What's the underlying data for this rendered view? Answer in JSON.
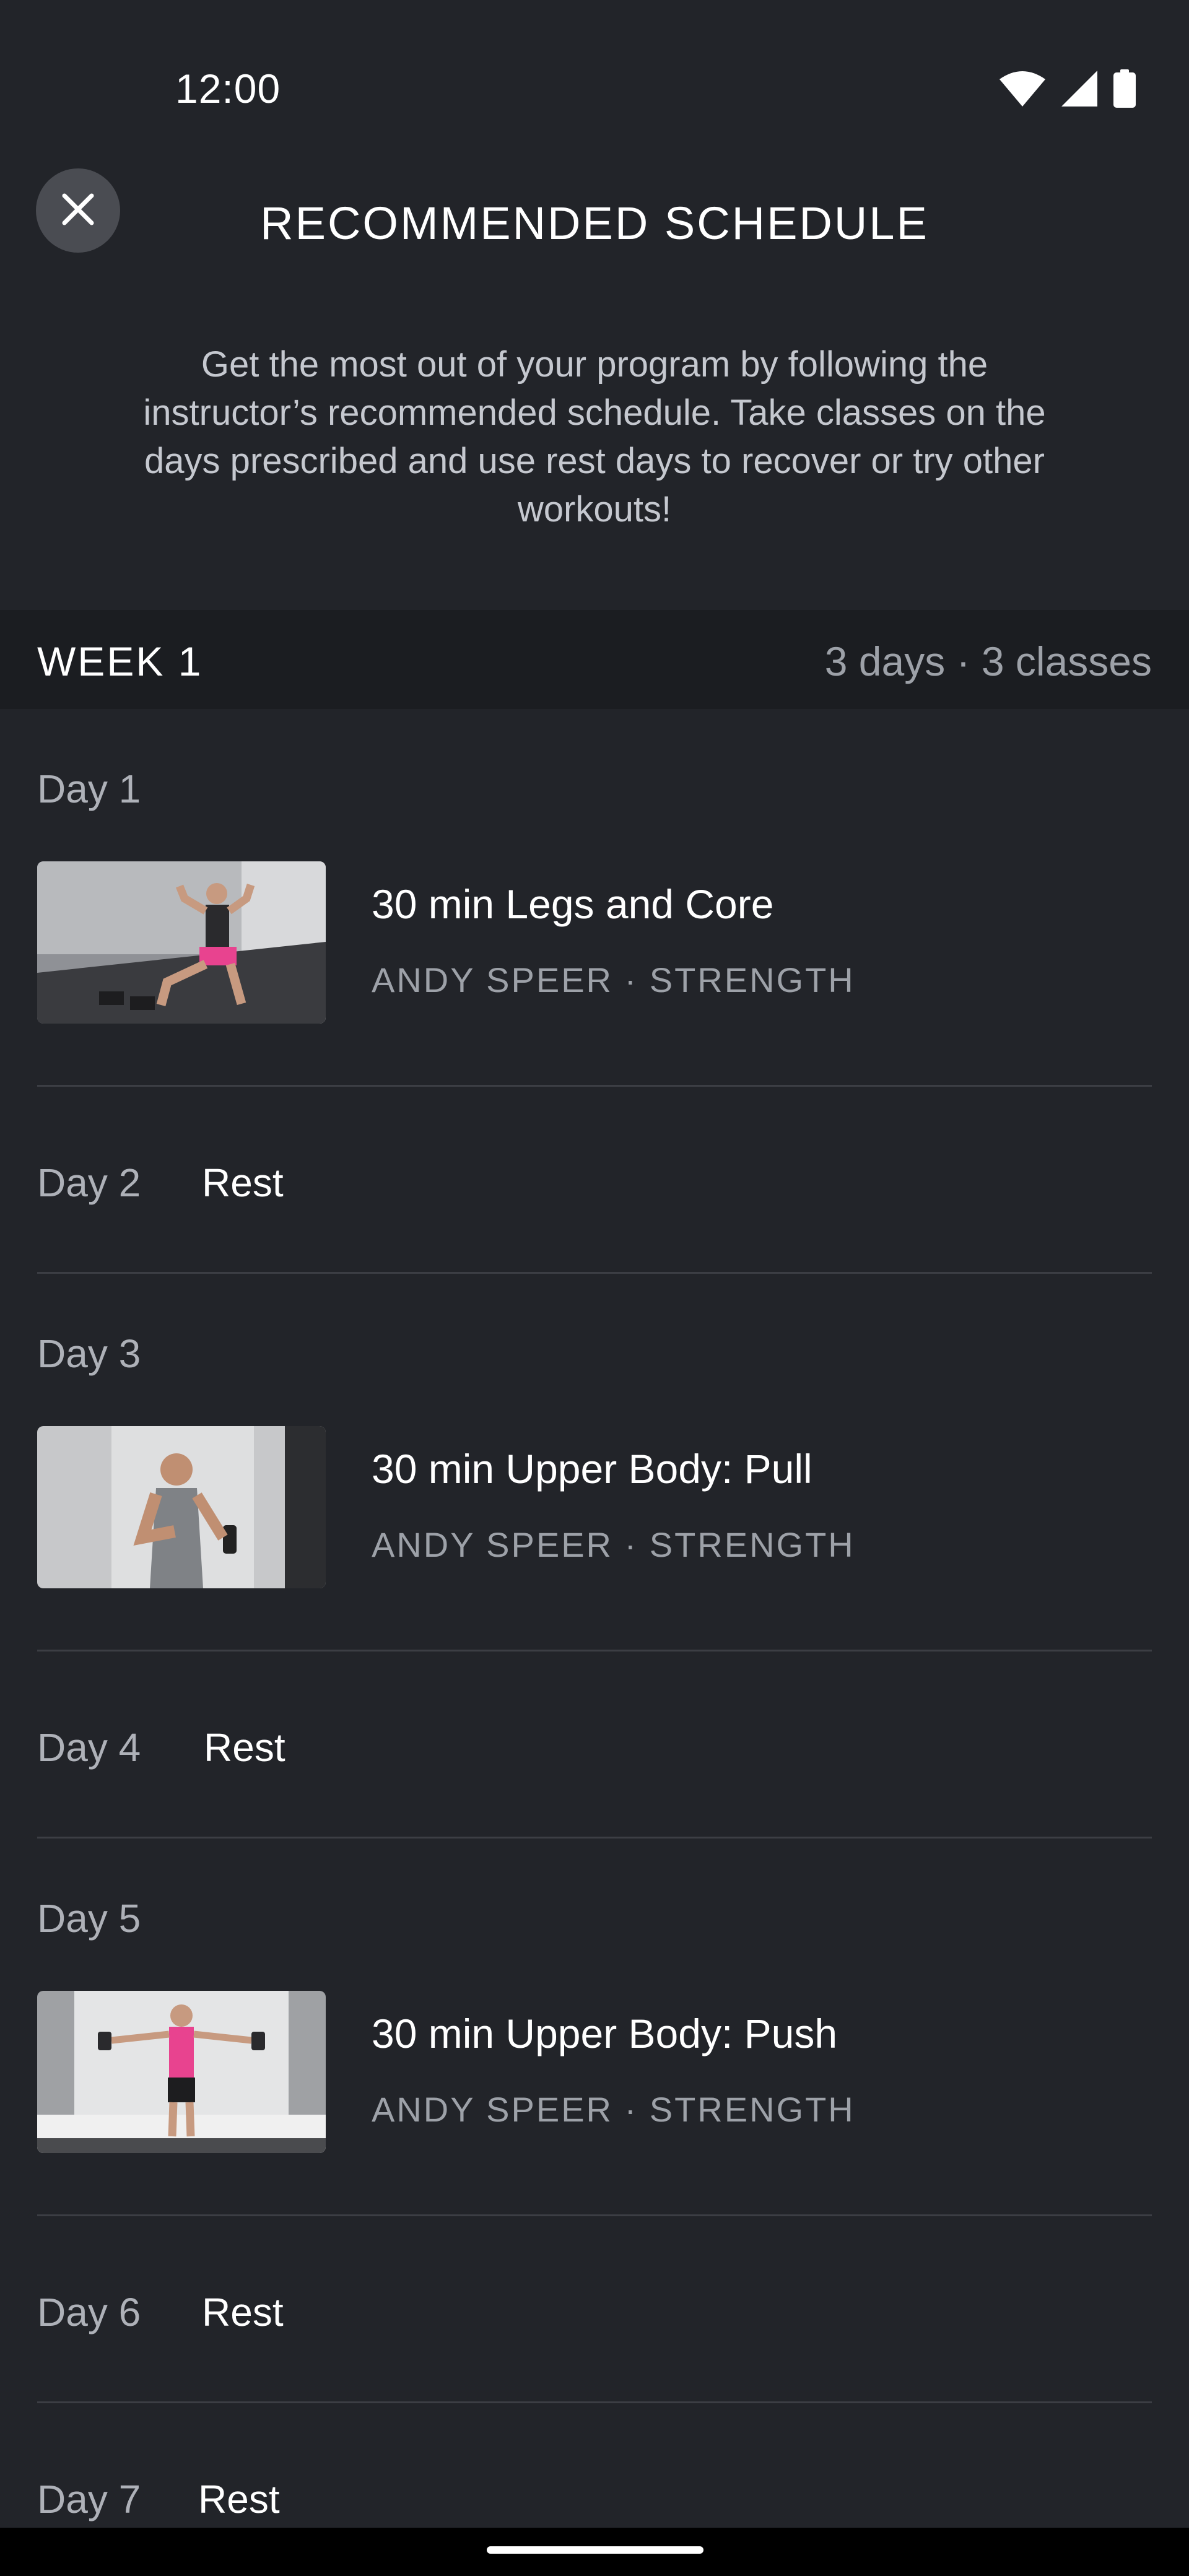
{
  "status_bar": {
    "time": "12:00",
    "icons": [
      "wifi-icon",
      "cellular-signal-icon",
      "battery-icon"
    ]
  },
  "header": {
    "close_icon": "close-icon",
    "title": "RECOMMENDED SCHEDULE"
  },
  "intro": {
    "text": "Get the most out of your program by following the instructor’s recommended schedule. Take classes on the days prescribed and use rest days to recover or try other workouts!"
  },
  "week": {
    "label": "WEEK 1",
    "meta": "3 days · 3 classes"
  },
  "days": [
    {
      "day": "Day 1",
      "type": "class",
      "title": "30 min Legs and Core",
      "subtitle": "ANDY SPEER · STRENGTH"
    },
    {
      "day": "Day 2",
      "type": "rest",
      "rest_label": "Rest"
    },
    {
      "day": "Day 3",
      "type": "class",
      "title": "30 min Upper Body: Pull",
      "subtitle": "ANDY SPEER · STRENGTH"
    },
    {
      "day": "Day 4",
      "type": "rest",
      "rest_label": "Rest"
    },
    {
      "day": "Day 5",
      "type": "class",
      "title": "30 min Upper Body: Push",
      "subtitle": "ANDY SPEER · STRENGTH"
    },
    {
      "day": "Day 6",
      "type": "rest",
      "rest_label": "Rest"
    },
    {
      "day": "Day 7",
      "type": "rest",
      "rest_label": "Rest"
    }
  ],
  "colors": {
    "background": "#222429",
    "week_bar": "#1b1d21",
    "secondary_text": "#9da1a8",
    "divider": "#3c3e44",
    "accent_pink": "#e8438f"
  }
}
